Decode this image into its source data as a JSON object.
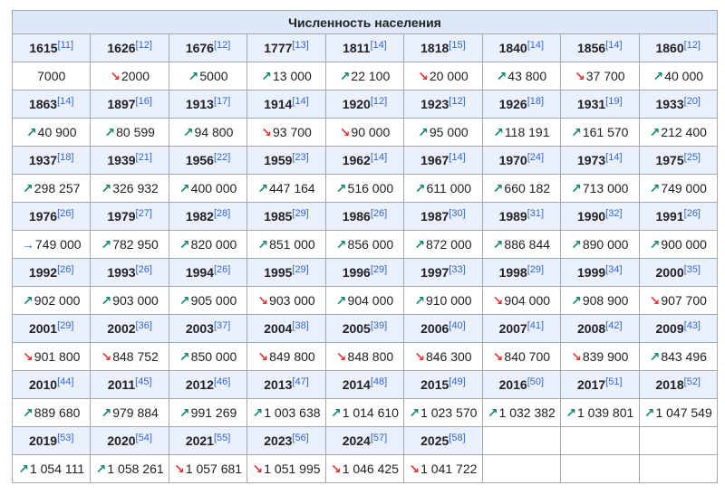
{
  "caption": "Численность населения",
  "rows": [
    {
      "years": [
        {
          "year": "1615",
          "ref": "[11]"
        },
        {
          "year": "1626",
          "ref": "[12]"
        },
        {
          "year": "1676",
          "ref": "[12]"
        },
        {
          "year": "1777",
          "ref": "[13]"
        },
        {
          "year": "1811",
          "ref": "[14]"
        },
        {
          "year": "1818",
          "ref": "[15]"
        },
        {
          "year": "1840",
          "ref": "[14]"
        },
        {
          "year": "1856",
          "ref": "[14]"
        },
        {
          "year": "1860",
          "ref": "[12]"
        }
      ],
      "values": [
        {
          "trend": "none",
          "value": "7000"
        },
        {
          "trend": "down",
          "value": "2000"
        },
        {
          "trend": "up",
          "value": "5000"
        },
        {
          "trend": "up",
          "value": "13 000"
        },
        {
          "trend": "up",
          "value": "22 100"
        },
        {
          "trend": "down",
          "value": "20 000"
        },
        {
          "trend": "up",
          "value": "43 800"
        },
        {
          "trend": "down",
          "value": "37 700"
        },
        {
          "trend": "up",
          "value": "40 000"
        }
      ]
    },
    {
      "years": [
        {
          "year": "1863",
          "ref": "[14]"
        },
        {
          "year": "1897",
          "ref": "[16]"
        },
        {
          "year": "1913",
          "ref": "[17]"
        },
        {
          "year": "1914",
          "ref": "[14]"
        },
        {
          "year": "1920",
          "ref": "[12]"
        },
        {
          "year": "1923",
          "ref": "[12]"
        },
        {
          "year": "1926",
          "ref": "[18]"
        },
        {
          "year": "1931",
          "ref": "[19]"
        },
        {
          "year": "1933",
          "ref": "[20]"
        }
      ],
      "values": [
        {
          "trend": "up",
          "value": "40 900"
        },
        {
          "trend": "up",
          "value": "80 599"
        },
        {
          "trend": "up",
          "value": "94 800"
        },
        {
          "trend": "down",
          "value": "93 700"
        },
        {
          "trend": "down",
          "value": "90 000"
        },
        {
          "trend": "up",
          "value": "95 000"
        },
        {
          "trend": "up",
          "value": "118 191"
        },
        {
          "trend": "up",
          "value": "161 570"
        },
        {
          "trend": "up",
          "value": "212 400"
        }
      ]
    },
    {
      "years": [
        {
          "year": "1937",
          "ref": "[18]"
        },
        {
          "year": "1939",
          "ref": "[21]"
        },
        {
          "year": "1956",
          "ref": "[22]"
        },
        {
          "year": "1959",
          "ref": "[23]"
        },
        {
          "year": "1962",
          "ref": "[14]"
        },
        {
          "year": "1967",
          "ref": "[14]"
        },
        {
          "year": "1970",
          "ref": "[24]"
        },
        {
          "year": "1973",
          "ref": "[14]"
        },
        {
          "year": "1975",
          "ref": "[25]"
        }
      ],
      "values": [
        {
          "trend": "up",
          "value": "298 257"
        },
        {
          "trend": "up",
          "value": "326 932"
        },
        {
          "trend": "up",
          "value": "400 000"
        },
        {
          "trend": "up",
          "value": "447 164"
        },
        {
          "trend": "up",
          "value": "516 000"
        },
        {
          "trend": "up",
          "value": "611 000"
        },
        {
          "trend": "up",
          "value": "660 182"
        },
        {
          "trend": "up",
          "value": "713 000"
        },
        {
          "trend": "up",
          "value": "749 000"
        }
      ]
    },
    {
      "years": [
        {
          "year": "1976",
          "ref": "[26]"
        },
        {
          "year": "1979",
          "ref": "[27]"
        },
        {
          "year": "1982",
          "ref": "[28]"
        },
        {
          "year": "1985",
          "ref": "[29]"
        },
        {
          "year": "1986",
          "ref": "[26]"
        },
        {
          "year": "1987",
          "ref": "[30]"
        },
        {
          "year": "1989",
          "ref": "[31]"
        },
        {
          "year": "1990",
          "ref": "[32]"
        },
        {
          "year": "1991",
          "ref": "[26]"
        }
      ],
      "values": [
        {
          "trend": "flat",
          "value": "749 000"
        },
        {
          "trend": "up",
          "value": "782 950"
        },
        {
          "trend": "up",
          "value": "820 000"
        },
        {
          "trend": "up",
          "value": "851 000"
        },
        {
          "trend": "up",
          "value": "856 000"
        },
        {
          "trend": "up",
          "value": "872 000"
        },
        {
          "trend": "up",
          "value": "886 844"
        },
        {
          "trend": "up",
          "value": "890 000"
        },
        {
          "trend": "up",
          "value": "900 000"
        }
      ]
    },
    {
      "years": [
        {
          "year": "1992",
          "ref": "[26]"
        },
        {
          "year": "1993",
          "ref": "[26]"
        },
        {
          "year": "1994",
          "ref": "[26]"
        },
        {
          "year": "1995",
          "ref": "[29]"
        },
        {
          "year": "1996",
          "ref": "[29]"
        },
        {
          "year": "1997",
          "ref": "[33]"
        },
        {
          "year": "1998",
          "ref": "[29]"
        },
        {
          "year": "1999",
          "ref": "[34]"
        },
        {
          "year": "2000",
          "ref": "[35]"
        }
      ],
      "values": [
        {
          "trend": "up",
          "value": "902 000"
        },
        {
          "trend": "up",
          "value": "903 000"
        },
        {
          "trend": "up",
          "value": "905 000"
        },
        {
          "trend": "down",
          "value": "903 000"
        },
        {
          "trend": "up",
          "value": "904 000"
        },
        {
          "trend": "up",
          "value": "910 000"
        },
        {
          "trend": "down",
          "value": "904 000"
        },
        {
          "trend": "up",
          "value": "908 900"
        },
        {
          "trend": "down",
          "value": "907 700"
        }
      ]
    },
    {
      "years": [
        {
          "year": "2001",
          "ref": "[29]"
        },
        {
          "year": "2002",
          "ref": "[36]"
        },
        {
          "year": "2003",
          "ref": "[37]"
        },
        {
          "year": "2004",
          "ref": "[38]"
        },
        {
          "year": "2005",
          "ref": "[39]"
        },
        {
          "year": "2006",
          "ref": "[40]"
        },
        {
          "year": "2007",
          "ref": "[41]"
        },
        {
          "year": "2008",
          "ref": "[42]"
        },
        {
          "year": "2009",
          "ref": "[43]"
        }
      ],
      "values": [
        {
          "trend": "down",
          "value": "901 800"
        },
        {
          "trend": "down",
          "value": "848 752"
        },
        {
          "trend": "up",
          "value": "850 000"
        },
        {
          "trend": "down",
          "value": "849 800"
        },
        {
          "trend": "down",
          "value": "848 800"
        },
        {
          "trend": "down",
          "value": "846 300"
        },
        {
          "trend": "down",
          "value": "840 700"
        },
        {
          "trend": "down",
          "value": "839 900"
        },
        {
          "trend": "up",
          "value": "843 496"
        }
      ]
    },
    {
      "years": [
        {
          "year": "2010",
          "ref": "[44]"
        },
        {
          "year": "2011",
          "ref": "[45]"
        },
        {
          "year": "2012",
          "ref": "[46]"
        },
        {
          "year": "2013",
          "ref": "[47]"
        },
        {
          "year": "2014",
          "ref": "[48]"
        },
        {
          "year": "2015",
          "ref": "[49]"
        },
        {
          "year": "2016",
          "ref": "[50]"
        },
        {
          "year": "2017",
          "ref": "[51]"
        },
        {
          "year": "2018",
          "ref": "[52]"
        }
      ],
      "values": [
        {
          "trend": "up",
          "value": "889 680"
        },
        {
          "trend": "up",
          "value": "979 884"
        },
        {
          "trend": "up",
          "value": "991 269"
        },
        {
          "trend": "up",
          "value": "1 003 638"
        },
        {
          "trend": "up",
          "value": "1 014 610"
        },
        {
          "trend": "up",
          "value": "1 023 570"
        },
        {
          "trend": "up",
          "value": "1 032 382"
        },
        {
          "trend": "up",
          "value": "1 039 801"
        },
        {
          "trend": "up",
          "value": "1 047 549"
        }
      ]
    },
    {
      "years": [
        {
          "year": "2019",
          "ref": "[53]"
        },
        {
          "year": "2020",
          "ref": "[54]"
        },
        {
          "year": "2021",
          "ref": "[55]"
        },
        {
          "year": "2023",
          "ref": "[56]"
        },
        {
          "year": "2024",
          "ref": "[57]"
        },
        {
          "year": "2025",
          "ref": "[58]"
        },
        null,
        null,
        null
      ],
      "values": [
        {
          "trend": "up",
          "value": "1 054 111"
        },
        {
          "trend": "up",
          "value": "1 058 261"
        },
        {
          "trend": "down",
          "value": "1 057 681"
        },
        {
          "trend": "down",
          "value": "1 051 995"
        },
        {
          "trend": "down",
          "value": "1 046 425"
        },
        {
          "trend": "down",
          "value": "1 041 722"
        },
        null,
        null,
        null
      ]
    }
  ],
  "trend_glyphs": {
    "up": "↗",
    "down": "↘",
    "flat": "→",
    "none": ""
  },
  "colors": {
    "up": "#14866d",
    "down": "#d33333",
    "flat": "#3366cc",
    "ref_link": "#3366cc"
  }
}
